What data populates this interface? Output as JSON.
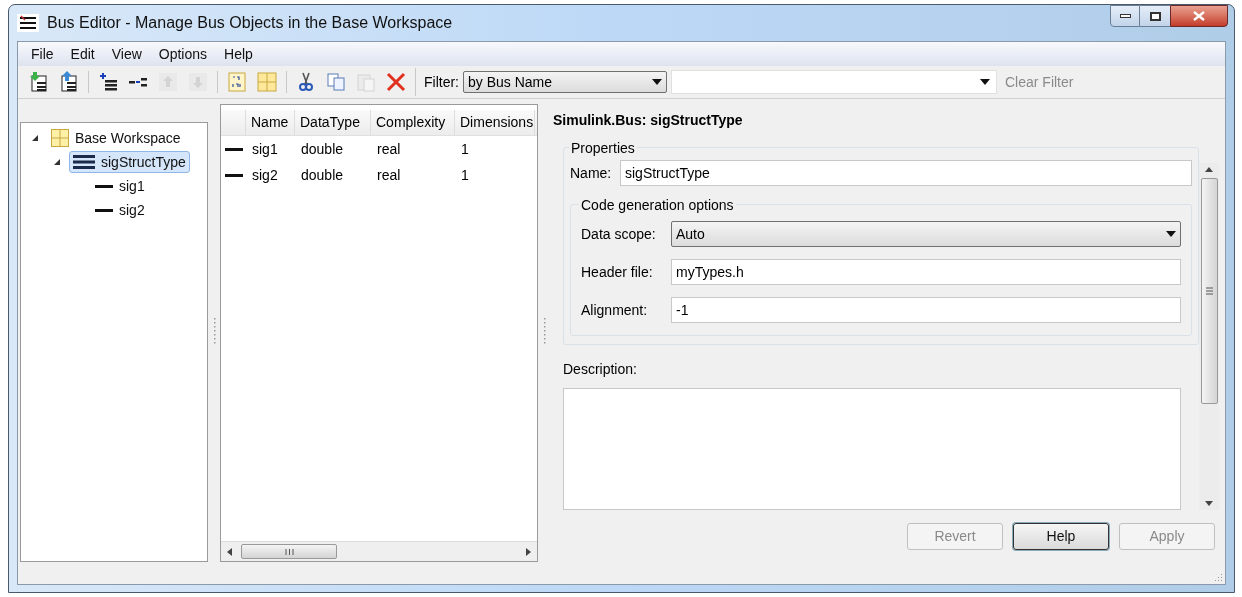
{
  "window": {
    "title": "Bus Editor - Manage Bus Objects in the Base Workspace"
  },
  "menu": [
    "File",
    "Edit",
    "View",
    "Options",
    "Help"
  ],
  "toolbar": {
    "tools": [
      {
        "kind": "import",
        "disabled": false
      },
      {
        "kind": "export",
        "disabled": false
      },
      {
        "kind": "separator"
      },
      {
        "kind": "insert-bus",
        "disabled": false
      },
      {
        "kind": "insert-element",
        "disabled": false
      },
      {
        "kind": "move-up",
        "disabled": true
      },
      {
        "kind": "move-down",
        "disabled": true
      },
      {
        "kind": "separator"
      },
      {
        "kind": "binary",
        "disabled": false
      },
      {
        "kind": "grid",
        "disabled": false
      },
      {
        "kind": "separator"
      },
      {
        "kind": "cut",
        "disabled": false
      },
      {
        "kind": "copy",
        "disabled": false
      },
      {
        "kind": "paste",
        "disabled": true
      },
      {
        "kind": "delete",
        "disabled": false
      }
    ],
    "filter_label": "Filter:",
    "filter_mode": "by Bus Name",
    "clear_filter": {
      "label": "Clear Filter",
      "disabled": true
    }
  },
  "tree": [
    {
      "label": "Base Workspace",
      "kind": "workspace",
      "expanded": true,
      "selected": false,
      "children": [
        {
          "label": "sigStructType",
          "kind": "bus",
          "expanded": true,
          "selected": true,
          "children": [
            {
              "label": "sig1",
              "kind": "element",
              "selected": false
            },
            {
              "label": "sig2",
              "kind": "element",
              "selected": false
            }
          ]
        }
      ]
    }
  ],
  "table": {
    "columns": [
      "Name",
      "DataType",
      "Complexity",
      "Dimensions"
    ],
    "rows": [
      {
        "cells": [
          "sig1",
          "double",
          "real",
          "1"
        ]
      },
      {
        "cells": [
          "sig2",
          "double",
          "real",
          "1"
        ]
      }
    ]
  },
  "details": {
    "heading": "Simulink.Bus: sigStructType",
    "properties_label": "Properties",
    "name_label": "Name:",
    "name_value": "sigStructType",
    "codegen_label": "Code generation options",
    "data_scope_label": "Data scope:",
    "data_scope_value": "Auto",
    "header_label": "Header file:",
    "header_value": "myTypes.h",
    "alignment_label": "Alignment:",
    "alignment_value": "-1",
    "description_label": "Description:"
  },
  "buttons": [
    {
      "label": "Revert",
      "disabled": true,
      "default": false
    },
    {
      "label": "Help",
      "disabled": false,
      "default": true
    },
    {
      "label": "Apply",
      "disabled": true,
      "default": false
    }
  ]
}
